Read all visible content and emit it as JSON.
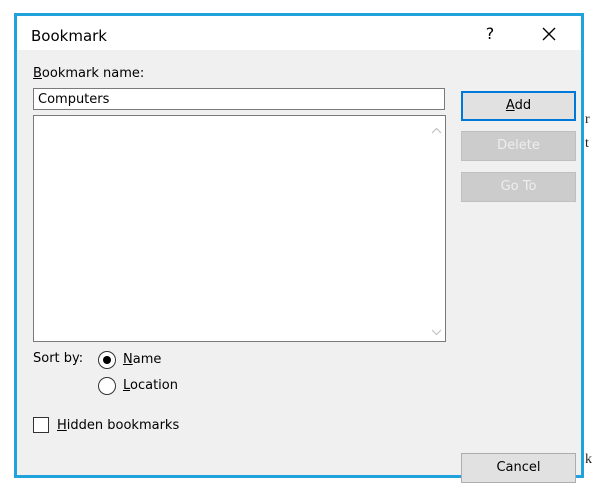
{
  "dialog": {
    "title": "Bookmark",
    "help_label": "?",
    "close_label": "close"
  },
  "form": {
    "name_label_accel": "B",
    "name_label_rest": "ookmark name:",
    "name_value": "Computers",
    "bookmarks": []
  },
  "buttons": {
    "add_accel": "A",
    "add_rest": "dd",
    "delete": "Delete",
    "goto": "Go To",
    "cancel": "Cancel"
  },
  "sort": {
    "label": "Sort by:",
    "options": [
      {
        "accel": "N",
        "rest": "ame",
        "selected": true
      },
      {
        "accel": "L",
        "rest": "ocation",
        "selected": false
      }
    ]
  },
  "hidden": {
    "accel": "H",
    "rest": "idden bookmarks",
    "checked": false
  },
  "colors": {
    "accent": "#20a2dd",
    "primary_border": "#0078d7"
  }
}
